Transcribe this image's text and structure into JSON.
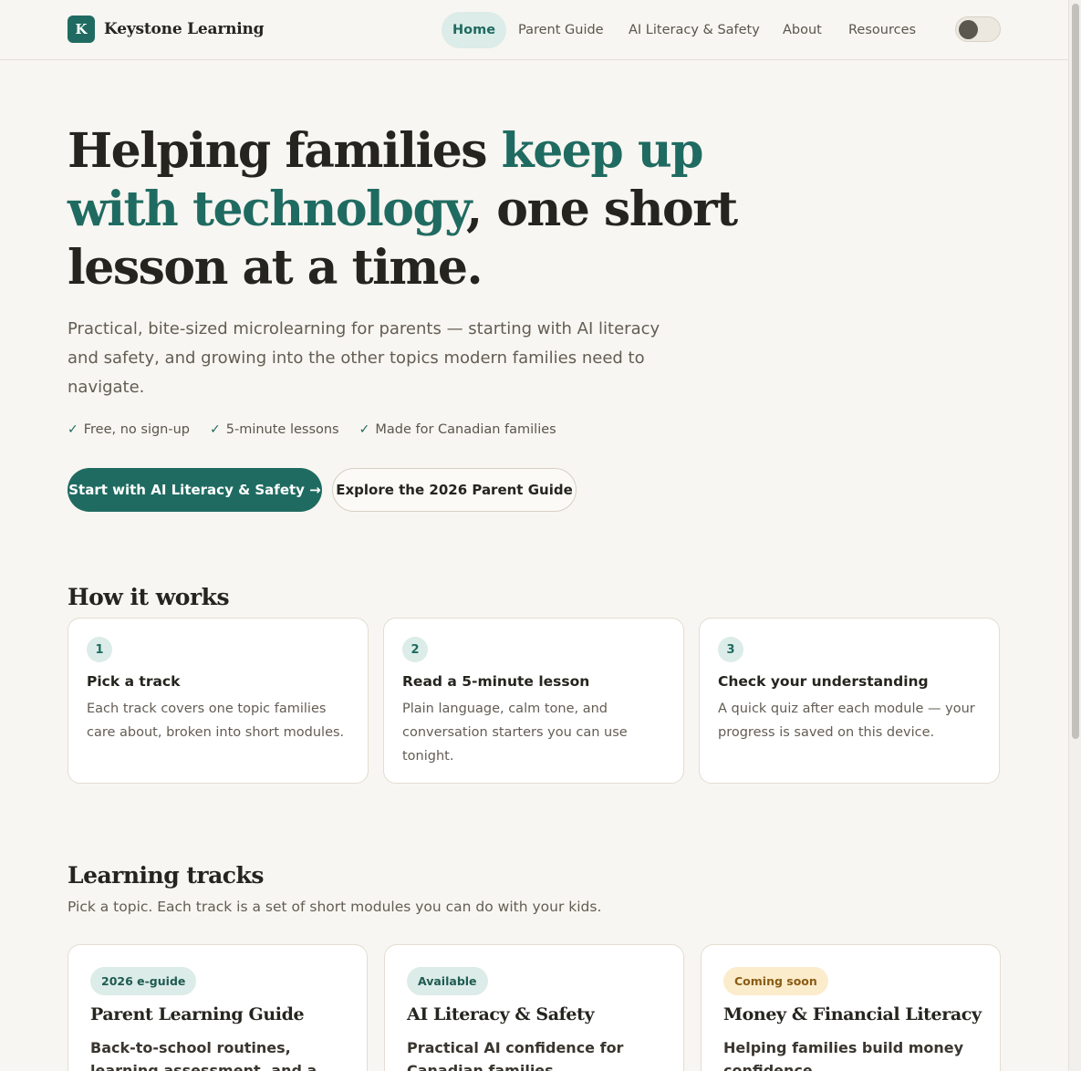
{
  "header": {
    "brand_letter": "K",
    "brand_name": "Keystone Learning",
    "nav": [
      {
        "label": "Home",
        "active": true
      },
      {
        "label": "Parent Guide"
      },
      {
        "label": "AI Literacy & Safety"
      },
      {
        "label": "About"
      },
      {
        "label": "Resources"
      }
    ],
    "theme_toggle_on": false
  },
  "hero": {
    "title_part1": "Helping families ",
    "title_accent": "keep up with technology",
    "title_part2": ", one short lesson at a time.",
    "subtitle": "Practical, bite-sized microlearning for parents — starting with AI literacy and safety, and growing into the other topics modern families need to navigate.",
    "checks": [
      "Free, no sign-up",
      "5-minute lessons",
      "Made for Canadian families"
    ],
    "check_glyph": "✓",
    "primary_cta": "Start with AI Literacy & Safety →",
    "secondary_cta": "Explore the 2026 Parent Guide"
  },
  "how_it_works": {
    "title": "How it works",
    "steps": [
      {
        "num": "1",
        "title": "Pick a track",
        "body": "Each track covers one topic families care about, broken into short modules."
      },
      {
        "num": "2",
        "title": "Read a 5-minute lesson",
        "body": "Plain language, calm tone, and conversation starters you can use tonight."
      },
      {
        "num": "3",
        "title": "Check your understanding",
        "body": "A quick quiz after each module — your progress is saved on this device."
      }
    ]
  },
  "tracks": {
    "title": "Learning tracks",
    "subtitle": "Pick a topic. Each track is a set of short modules you can do with your kids.",
    "items": [
      {
        "badge": "2026 e-guide",
        "title": "Parent Learning Guide",
        "desc": "Back-to-school routines, learning assessment, and a first-month"
      },
      {
        "badge": "Available",
        "title": "AI Literacy & Safety",
        "desc": "Practical AI confidence for Canadian families"
      },
      {
        "badge": "Coming soon",
        "title": "Money & Financial Literacy",
        "desc": "Helping families build money confidence"
      }
    ]
  },
  "colors": {
    "accent": "#1f6b61",
    "background": "#f8f6f2",
    "badge_soon": "#fbeccc"
  }
}
